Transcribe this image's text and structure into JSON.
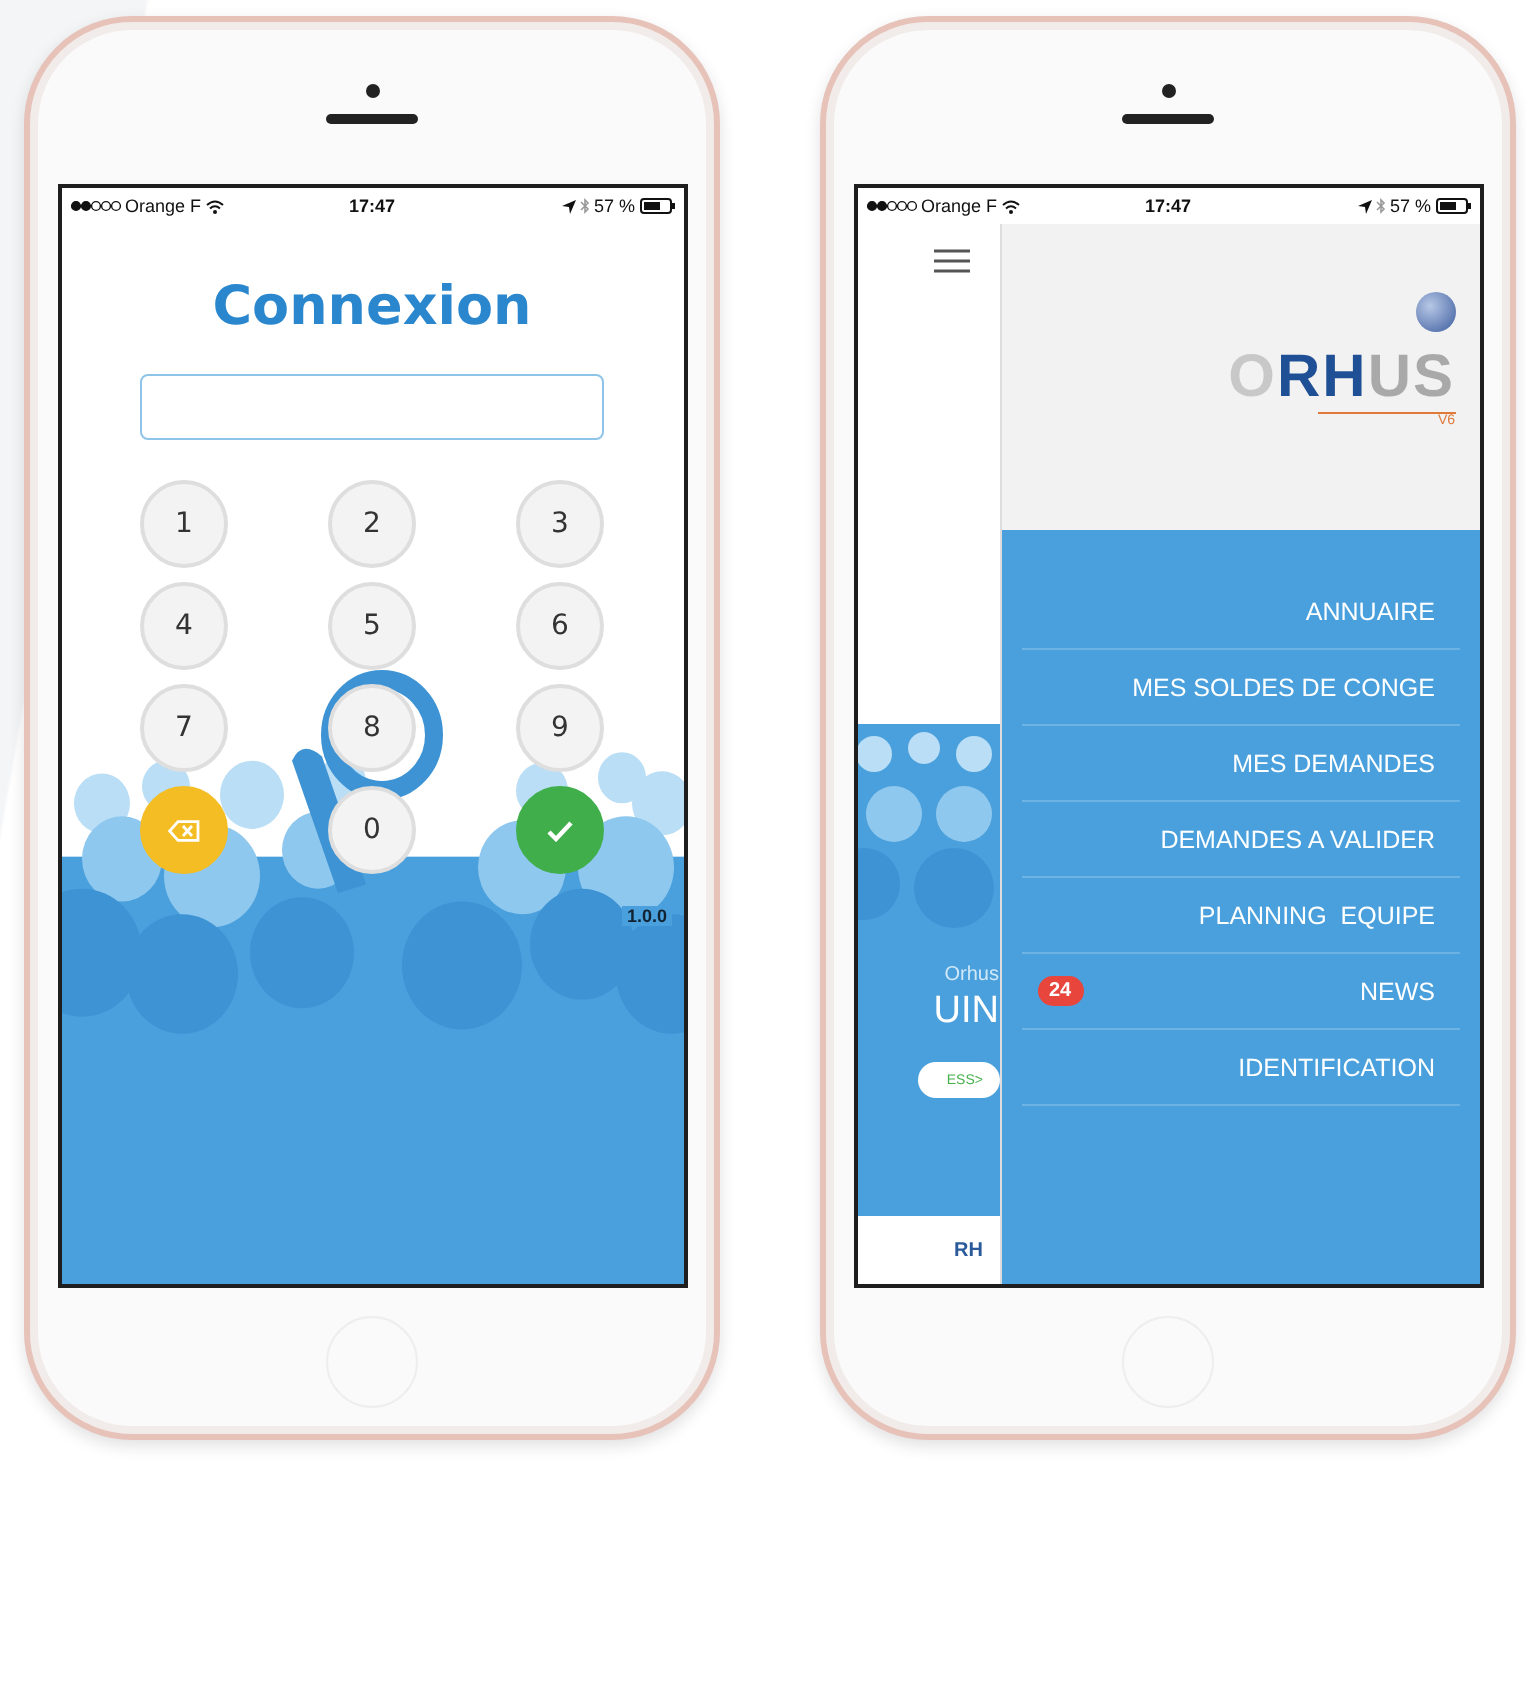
{
  "phones": [
    {
      "kind": "login",
      "status_bar": {
        "carrier": "Orange F",
        "time": "17:47",
        "battery": "57 %"
      },
      "title": "Connexion",
      "keys": [
        {
          "kind": "digit",
          "label": "1"
        },
        {
          "kind": "digit",
          "label": "2"
        },
        {
          "kind": "digit",
          "label": "3"
        },
        {
          "kind": "digit",
          "label": "4"
        },
        {
          "kind": "digit",
          "label": "5"
        },
        {
          "kind": "digit",
          "label": "6"
        },
        {
          "kind": "digit",
          "label": "7"
        },
        {
          "kind": "digit",
          "label": "8"
        },
        {
          "kind": "digit",
          "label": "9"
        },
        {
          "kind": "delete"
        },
        {
          "kind": "digit",
          "label": "0"
        },
        {
          "kind": "confirm"
        }
      ],
      "version": "1.0.0"
    },
    {
      "kind": "menu",
      "status_bar": {
        "carrier": "Orange F",
        "time": "17:47",
        "battery": "57 %"
      },
      "background": {
        "subtitle": "Orhus",
        "name": "UIN",
        "button": "ESS>",
        "footer_logo": "RH"
      },
      "logo": {
        "text": "ORHUS",
        "version": "V6"
      },
      "menu_items": [
        {
          "label": "ANNUAIRE"
        },
        {
          "label": "MES SOLDES DE CONGE"
        },
        {
          "label": "MES DEMANDES"
        },
        {
          "label": "DEMANDES A VALIDER"
        },
        {
          "label": "PLANNING  EQUIPE"
        },
        {
          "label": "NEWS",
          "badge": "24"
        },
        {
          "label": "IDENTIFICATION"
        }
      ]
    }
  ]
}
